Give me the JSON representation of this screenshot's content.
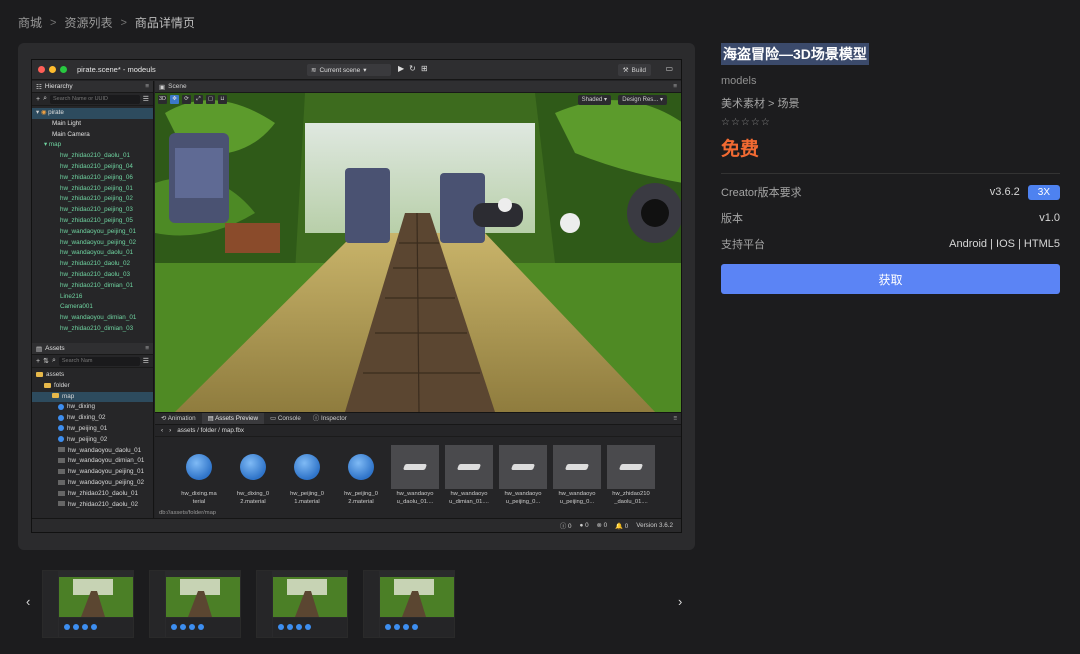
{
  "breadcrumb": {
    "items": [
      "商城",
      "资源列表",
      "商品详情页"
    ],
    "separator": ">"
  },
  "editor": {
    "doc_title": "pirate.scene* - modeuls",
    "scene_select": "Current scene",
    "build_label": "Build",
    "hierarchy": {
      "title": "Hierarchy",
      "search_placeholder": "Search Name or UUID",
      "root": "pirate",
      "nodes": [
        {
          "label": "Main Light",
          "color": "white"
        },
        {
          "label": "Main Camera",
          "color": "white"
        },
        {
          "label": "map",
          "color": "green"
        },
        {
          "label": "hw_zhidao210_daolu_01",
          "color": "green"
        },
        {
          "label": "hw_zhidao210_peijing_04",
          "color": "green"
        },
        {
          "label": "hw_zhidao210_peijing_06",
          "color": "green"
        },
        {
          "label": "hw_zhidao210_peijing_01",
          "color": "green"
        },
        {
          "label": "hw_zhidao210_peijing_02",
          "color": "green"
        },
        {
          "label": "hw_zhidao210_peijing_03",
          "color": "green"
        },
        {
          "label": "hw_zhidao210_peijing_05",
          "color": "green"
        },
        {
          "label": "hw_wandaoyou_peijing_01",
          "color": "green"
        },
        {
          "label": "hw_wandaoyou_peijing_02",
          "color": "green"
        },
        {
          "label": "hw_wandaoyou_daolu_01",
          "color": "green"
        },
        {
          "label": "hw_zhidao210_daolu_02",
          "color": "green"
        },
        {
          "label": "hw_zhidao210_daolu_03",
          "color": "green"
        },
        {
          "label": "hw_zhidao210_dimian_01",
          "color": "green"
        },
        {
          "label": "Line216",
          "color": "green"
        },
        {
          "label": "Camera001",
          "color": "green"
        },
        {
          "label": "hw_wandaoyou_dimian_01",
          "color": "green"
        },
        {
          "label": "hw_zhidao210_dimian_03",
          "color": "green"
        }
      ]
    },
    "assets_panel": {
      "title": "Assets",
      "search_placeholder": "Search Nam",
      "items": [
        {
          "label": "assets",
          "type": "folder"
        },
        {
          "label": "folder",
          "type": "folder"
        },
        {
          "label": "map",
          "type": "folder"
        },
        {
          "label": "hw_dixing",
          "type": "material"
        },
        {
          "label": "hw_dixing_02",
          "type": "material"
        },
        {
          "label": "hw_peijing_01",
          "type": "material"
        },
        {
          "label": "hw_peijing_02",
          "type": "material"
        },
        {
          "label": "hw_wandaoyou_daolu_01",
          "type": "mesh"
        },
        {
          "label": "hw_wandaoyou_dimian_01",
          "type": "mesh"
        },
        {
          "label": "hw_wandaoyou_peijing_01",
          "type": "mesh"
        },
        {
          "label": "hw_wandaoyou_peijing_02",
          "type": "mesh"
        },
        {
          "label": "hw_zhidao210_daolu_01",
          "type": "mesh"
        },
        {
          "label": "hw_zhidao210_daolu_02",
          "type": "mesh"
        }
      ]
    },
    "scene": {
      "tab": "Scene",
      "mode_3d": "3D",
      "shading": "Shaded",
      "design_res": "Design Res..."
    },
    "bottom_tabs": [
      "Animation",
      "Assets Preview",
      "Console",
      "Inspector"
    ],
    "preview_path": "assets / folder / map.fbx",
    "preview_items": [
      {
        "name": "hw_dixing.ma terial",
        "kind": "material"
      },
      {
        "name": "hw_dixing_0 2.material",
        "kind": "material"
      },
      {
        "name": "hw_peijing_0 1.material",
        "kind": "material"
      },
      {
        "name": "hw_peijing_0 2.material",
        "kind": "material"
      },
      {
        "name": "hw_wandaoyo u_daolu_01....",
        "kind": "mesh"
      },
      {
        "name": "hw_wandaoyo u_dimian_01....",
        "kind": "mesh"
      },
      {
        "name": "hw_wandaoyo u_peijing_0...",
        "kind": "mesh"
      },
      {
        "name": "hw_wandaoyo u_peijing_0...",
        "kind": "mesh"
      },
      {
        "name": "hw_zhidao210 _daolu_01....",
        "kind": "mesh"
      }
    ],
    "db_path": "db://assets/folder/map",
    "status": {
      "info": "0",
      "warn": "0",
      "err": "0",
      "notif": "0",
      "version": "Version 3.6.2"
    }
  },
  "product": {
    "title": "海盗冒险—3D场景模型",
    "category": "models",
    "tags": "美术素材 > 场景",
    "stars": "☆☆☆☆☆",
    "price": "免费",
    "specs": {
      "creator_label": "Creator版本要求",
      "creator_value": "v3.6.2",
      "creator_badge": "3X",
      "version_label": "版本",
      "version_value": "v1.0",
      "platform_label": "支持平台",
      "platform_value": "Android | IOS | HTML5"
    },
    "get_button": "获取"
  },
  "thumbnails": {
    "prev": "‹",
    "next": "›",
    "count": 4
  },
  "colors": {
    "accent": "#5b84f5",
    "price": "#f26a32",
    "badge": "#4e82f0"
  }
}
